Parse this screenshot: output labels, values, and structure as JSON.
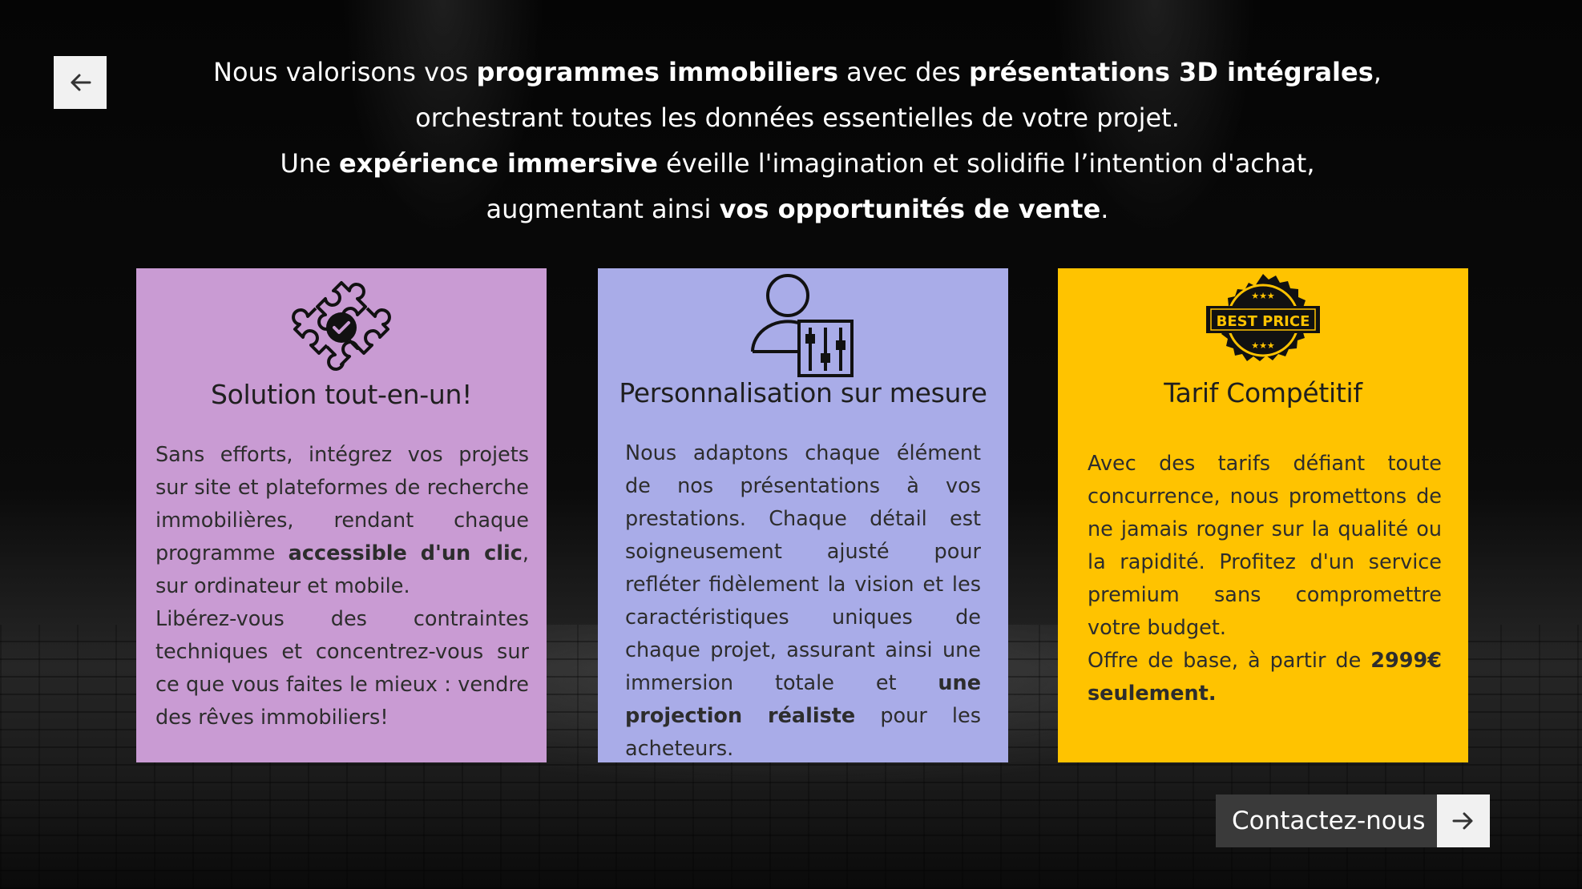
{
  "intro": {
    "l1_a": "Nous valorisons vos ",
    "l1_b": "programmes immobiliers",
    "l1_c": " avec des ",
    "l1_d": "présentations 3D intégrales",
    "l1_e": ",",
    "l2": "orchestrant toutes les données essentielles de votre projet.",
    "l3_a": "Une ",
    "l3_b": "expérience immersive",
    "l3_c": " éveille l'imagination et solidifie l’intention d'achat,",
    "l4_a": "augmentant ainsi ",
    "l4_b": "vos opportunités de vente",
    "l4_c": "."
  },
  "cards": [
    {
      "title": "Solution tout-en-un!",
      "p1_a": "Sans efforts, intégrez vos projets sur site et plateformes de recherche immobilières, rendant chaque programme ",
      "p1_b": "accessible d'un clic",
      "p1_c": ", sur ordinateur et mobile.",
      "p2": "Libérez-vous des contraintes techniques et concentrez-vous sur ce que vous faites le mieux : vendre des rêves immobiliers!",
      "icon": "puzzle-check-icon",
      "color": "#c99bd3"
    },
    {
      "title": "Personnalisation sur mesure",
      "p1_a": " Nous adaptons chaque élément de nos présentations à vos prestations. Chaque détail est soigneusement ajusté pour refléter fidèlement la vision et les caractéristiques uniques de chaque projet, assurant ainsi une immersion totale et ",
      "p1_b": "une projection réaliste",
      "p1_c": " pour les acheteurs.",
      "icon": "user-settings-icon",
      "color": "#a9ace8"
    },
    {
      "title": "Tarif Compétitif",
      "p1": " Avec des tarifs défiant toute concurrence, nous promettons de ne jamais rogner sur la qualité ou la rapidité. Profitez d'un service premium sans compromettre votre budget.",
      "p2_a": "Offre de base, à partir de ",
      "p2_b": "2999€ seulement.",
      "badge_text": "BEST PRICE",
      "icon": "best-price-badge-icon",
      "color": "#ffc300"
    }
  ],
  "contact": {
    "label": "Contactez-nous"
  },
  "icons": {
    "back": "arrow-left-icon",
    "forward": "arrow-right-icon"
  }
}
